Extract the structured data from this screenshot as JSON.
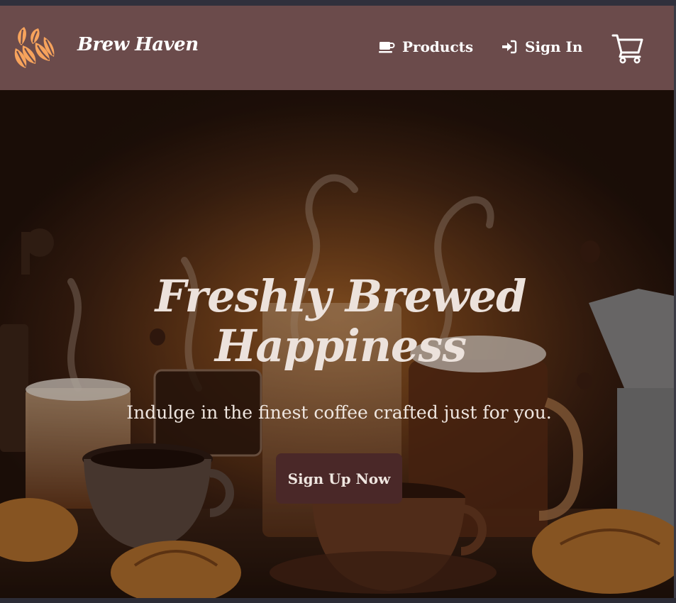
{
  "header": {
    "brand": "Brew Haven",
    "logo_icon": "coffee-beans-logo",
    "nav": [
      {
        "label": "Products",
        "icon": "coffee-cup-icon"
      },
      {
        "label": "Sign In",
        "icon": "sign-in-icon"
      }
    ],
    "cart_icon": "shopping-cart-icon"
  },
  "hero": {
    "title_line1": "Freshly Brewed",
    "title_line2": "Happiness",
    "subtitle": "Indulge in the finest coffee crafted just for you.",
    "cta_label": "Sign Up Now"
  },
  "colors": {
    "navbar": "#6b4b4b",
    "logo": "#f7a35c",
    "cta": "#4a2828",
    "hero_text": "#ece2dc"
  }
}
